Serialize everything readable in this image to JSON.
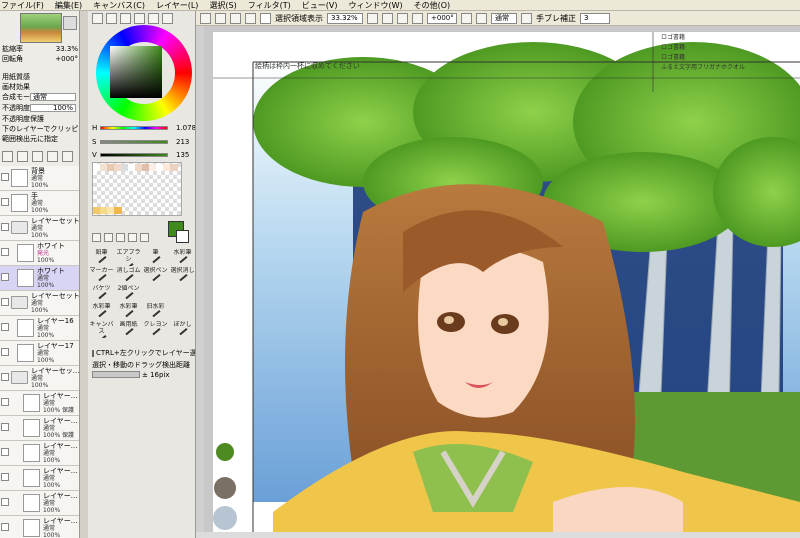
{
  "menu": [
    "ファイル(F)",
    "編集(E)",
    "キャンバス(C)",
    "レイヤー(L)",
    "選択(S)",
    "フィルタ(T)",
    "ビュー(V)",
    "ウィンドウ(W)",
    "その他(O)"
  ],
  "navigator": {
    "zoom_label": "拡縮率",
    "zoom_value": "33.3%",
    "angle_label": "回転角",
    "angle_value": "+000°"
  },
  "layer_props": {
    "texture_label": "用紙質感",
    "effect_label": "画材効果",
    "mode_label": "合成モード",
    "mode_value": "通常",
    "opacity_label": "不透明度",
    "opacity_value": "100%",
    "opt1": "不透明度保護",
    "opt2": "下のレイヤーでクリッピング",
    "opt3": "範囲検出元に指定"
  },
  "layers": [
    {
      "name": "背景",
      "mode": "通常",
      "opacity": "100%"
    },
    {
      "name": "手",
      "mode": "通常",
      "opacity": "100%"
    },
    {
      "name": "レイヤーセット1",
      "mode": "通常",
      "opacity": "100%"
    },
    {
      "name": "ホワイト",
      "mode": "発光",
      "opacity": "100%"
    },
    {
      "name": "ホワイト",
      "mode": "通常",
      "opacity": "100%"
    },
    {
      "name": "レイヤーセット2",
      "mode": "通常",
      "opacity": "100%"
    },
    {
      "name": "レイヤー16",
      "mode": "通常",
      "opacity": "100%"
    },
    {
      "name": "レイヤー17",
      "mode": "通常",
      "opacity": "100%"
    },
    {
      "name": "レイヤーセッ...",
      "mode": "通常",
      "opacity": "100%"
    },
    {
      "name": "レイヤー...",
      "mode": "通常",
      "opacity": "100% 保護"
    },
    {
      "name": "レイヤー...",
      "mode": "通常",
      "opacity": "100% 保護"
    },
    {
      "name": "レイヤー...",
      "mode": "通常",
      "opacity": "100%"
    },
    {
      "name": "レイヤー...",
      "mode": "通常",
      "opacity": "100%"
    },
    {
      "name": "レイヤー...",
      "mode": "通常",
      "opacity": "100%"
    },
    {
      "name": "レイヤー...",
      "mode": "通常",
      "opacity": "100%"
    }
  ],
  "color": {
    "h_label": "H",
    "h_value": "1.078",
    "s_label": "S",
    "s_value": "213",
    "v_label": "V",
    "v_value": "135",
    "main_color": "#3f8a1a"
  },
  "tools_row1": [
    "鉛筆",
    "エアブラシ",
    "筆",
    "水彩筆"
  ],
  "tools_row2": [
    "マーカー",
    "消しゴム",
    "選択ペン",
    "選択消し"
  ],
  "tools_row3": [
    "バケツ",
    "2値ペン",
    "",
    ""
  ],
  "tools_row4": [
    "水彩筆",
    "水彩筆",
    "旧水彩",
    ""
  ],
  "tools_row5": [
    "キャンバス",
    "画用紙",
    "クレヨン",
    "ぼかし"
  ],
  "tool_options": {
    "ctrl_label": "CTRL+左クリックでレイヤー選択",
    "drag_label": "選択・移動のドラッグ検出距離",
    "drag_value": "± 16pix"
  },
  "toolbar": {
    "selection_label": "選択領域表示",
    "zoom": "33.32%",
    "angle": "+000°",
    "mode": "通常",
    "stabilizer_label": "手ブレ補正",
    "stabilizer_value": "3"
  },
  "canvas": {
    "note_text": "絵柄は枠内一杯に収めてください",
    "guide1": "ロゴ書籍",
    "guide2": "ロゴ書籍",
    "guide3": "ロゴ書籍",
    "guide4": "ふるえ文字用フリガナホクオル"
  }
}
